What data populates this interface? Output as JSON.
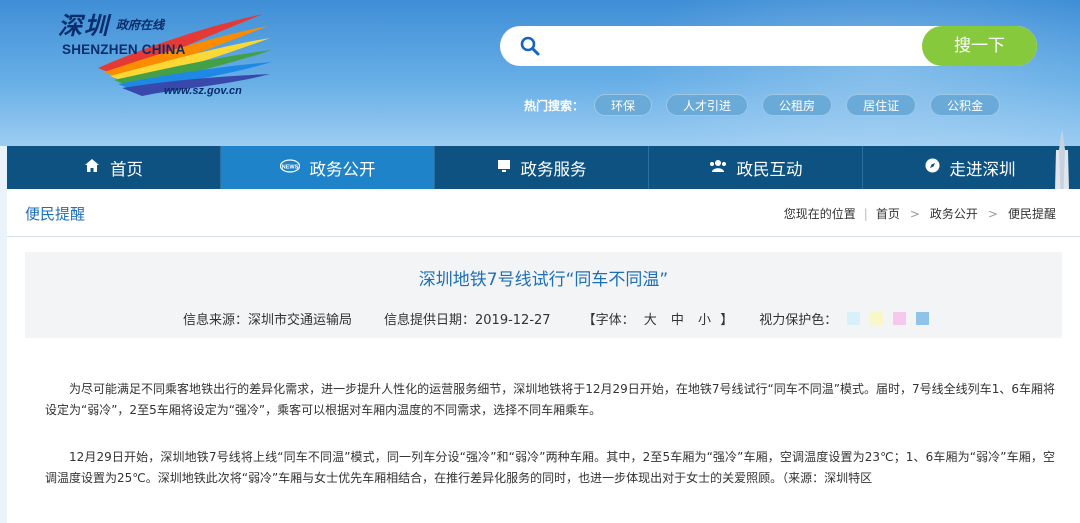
{
  "logo": {
    "cn": "深圳",
    "cn_sub": "政府在线",
    "en": "SHENZHEN CHINA",
    "url": "www.sz.gov.cn"
  },
  "search": {
    "placeholder": "",
    "button_label": "搜一下"
  },
  "hot_search": {
    "label": "热门搜索：",
    "tags": [
      "环保",
      "人才引进",
      "公租房",
      "居住证",
      "公积金"
    ]
  },
  "nav": {
    "items": [
      {
        "label": "首页",
        "icon": "home-icon"
      },
      {
        "label": "政务公开",
        "icon": "news-icon"
      },
      {
        "label": "政务服务",
        "icon": "monitor-icon"
      },
      {
        "label": "政民互动",
        "icon": "people-icon"
      },
      {
        "label": "走进深圳",
        "icon": "compass-icon"
      }
    ],
    "active_index": 1
  },
  "breadcrumb": {
    "category": "便民提醒",
    "prefix": "您现在的位置",
    "items": [
      "首页",
      "政务公开",
      "便民提醒"
    ]
  },
  "article": {
    "title": "深圳地铁7号线试行“同车不同温”",
    "source": "信息来源：深圳市交通运输局",
    "date": "信息提供日期：2019-12-27",
    "font_label": "【字体：",
    "font_sizes": [
      "大",
      "中",
      "小"
    ],
    "font_close": "】",
    "eye_label": "视力保护色：",
    "eye_colors": [
      "#d8f0fa",
      "#f7f7c9",
      "#f7c8ee",
      "#8ec3ea"
    ],
    "para1": "为尽可能满足不同乘客地铁出行的差异化需求，进一步提升人性化的运营服务细节，深圳地铁将于12月29日开始，在地铁7号线试行“同车不同温”模式。届时，7号线全线列车1、6车厢将设定为“弱冷”，2至5车厢将设定为“强冷”，乘客可以根据对车厢内温度的不同需求，选择不同车厢乘车。",
    "para2": "12月29日开始，深圳地铁7号线将上线“同车不同温”模式，同一列车分设“强冷”和“弱冷”两种车厢。其中，2至5车厢为“强冷”车厢，空调温度设置为23℃；1、6车厢为“弱冷”车厢，空调温度设置为25℃。深圳地铁此次将“弱冷”车厢与女士优先车厢相结合，在推行差异化服务的同时，也进一步体现出对于女士的关爱照顾。（来源：深圳特区"
  },
  "colors": {
    "nav_bg": "#0e5281",
    "nav_active": "#1f83c9",
    "search_button": "#86c93d",
    "title_blue": "#1e6fb8"
  }
}
